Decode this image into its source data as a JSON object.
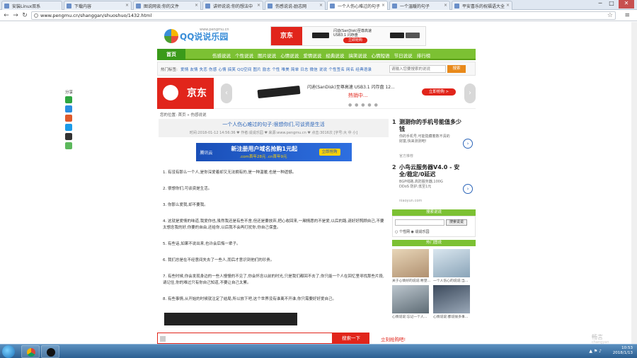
{
  "browser": {
    "tabs": [
      {
        "label": "安装Linux双系",
        "active": false
      },
      {
        "label": "下载内容",
        "active": false
      },
      {
        "label": "图说网谈:你的文件",
        "active": false
      },
      {
        "label": "讲师说说:你的想法中",
        "active": false
      },
      {
        "label": "伤感说说-励志网",
        "active": false
      },
      {
        "label": "一个人伤心难过的句子",
        "active": true
      },
      {
        "label": "一个温暖的句子",
        "active": false
      },
      {
        "label": "平安喜乐的祝福语大全",
        "active": false
      }
    ],
    "url": "www.pengmu.cn/shanggan/shuoshuo/1432.html",
    "window_controls": {
      "minimize": "─",
      "maximize": "□",
      "close": "✕"
    }
  },
  "site": {
    "logo_name": "QQ说说乐园",
    "logo_site": "www.pengmu.cn",
    "top_ad": {
      "brand": "京东",
      "desc": "闪迪(SanDisk)至尊高速 USB3.1 闪存盘",
      "buy": "立即抢购"
    },
    "nav": {
      "home": "首页",
      "links": [
        "伤感说说",
        "个性说说",
        "图片说说",
        "心情说说",
        "爱情说说",
        "经典说说",
        "搞笑说说",
        "心情短语",
        "节日说说",
        "排行榜"
      ]
    },
    "subnav": {
      "label": "热门标签:",
      "tags": "爱情 友情 失恋 伤感 心情 搞笑 QQ空间 图片 励志 个性 唯美 简单 日志 微信 说说 个性签名 网名 经典语录",
      "search_placeholder": "请输入您要搜索的说说",
      "search_button": "搜索"
    },
    "big_ad": {
      "brand": "京东",
      "desc": "闪迪(SanDisk)至尊高速 USB3.1 闪存盘 12...",
      "hot": "热销中...",
      "buy": "立即抢购 >",
      "dots": "● ● ● ● ●"
    },
    "share": {
      "label": "分享"
    }
  },
  "breadcrumb": "您的位置: 首页 » 伤感说说",
  "article": {
    "title": "一个人伤心难过的句子:很想你们,可谈资是生活",
    "meta": "时间:2018-01-12 14:56:36 ♥ 作者:说说乐园 ♥ 来源:www.pengmu.cn ♥ 点击:3016次 [字号:大 中 小]",
    "ad": {
      "brand": "腾讯云",
      "headline": "新注册用户域名抢购1元起",
      "sub": ".com首年28元 .cn首年9元",
      "btn": "立即抢购"
    },
    "paragraphs": [
      "1. 有没有那么一个人,是你深爱着却又无法拥有的,是一种温暖,也是一种遗憾。",
      "2. 很想你们,可谈资是生活。",
      "3. 你那么爱我,却不要我。",
      "4. 这就是爱情的味道,我爱你也,虽然我还是有些不舍,但还是要放弃,把心收回来,一厢情愿的不是爱,以后的路,请好好照顾自己,不要太想念我的好,你要的自由,还给你,以后我不会再打扰你,你自己保重。",
      "5. 有些话,如果不说出来,也许会后悔一辈子。",
      "6. 我们总是在不经意间失去了一些人,而后才意识到他们的珍贵。",
      "7. 有些时候,你会发现身边的一些人慢慢的不见了,你会怀念以前的时光,只是我们都回不去了,你只能一个人在回忆里寻找那些片段,请记住,你的难过只有你自己知道,不要让自己太累。",
      "8. 有些事情,从开始的时候就注定了结局,所以放下吧,这个世界没有谁离不开谁,你只需要好好爱自己。"
    ]
  },
  "sidebar": {
    "hot": [
      {
        "num": "1",
        "title": "测测你的手机号能值多少钱",
        "desc": "你的手机号,可能隐藏着数不清的财富,快来测测吧!",
        "src": "官方推荐"
      },
      {
        "num": "2",
        "title": "小鸟云服务器V4.0 - 安全/稳定/0延迟",
        "desc": "BGP线路,高防服务器,100G DDoS 防护,低至1元",
        "src": "niaoyun.com"
      }
    ],
    "search_header": "搜索说说",
    "search_button": "搜索说说",
    "radios": "○ 个性网 ◉ 说说乐园",
    "pics_header": "热门图说",
    "pics": [
      {
        "caption": "关于心情好的说说:希望..."
      },
      {
        "caption": "一个人伤心的说说:当..."
      },
      {
        "caption": "心情说说:忘记一个人..."
      },
      {
        "caption": "心情说说:都说很多事..."
      }
    ]
  },
  "bottom_bar": {
    "go": "搜索一下",
    "link": "立刻抢购吧!"
  },
  "watermark": {
    "name": "畅言",
    "sub": "changyan"
  },
  "taskbar": {
    "time": "10:53",
    "date": "2018/1/13"
  },
  "colors": {
    "accent": "#7cc133",
    "brand_red": "#e1251b",
    "link": "#2a64b8"
  }
}
